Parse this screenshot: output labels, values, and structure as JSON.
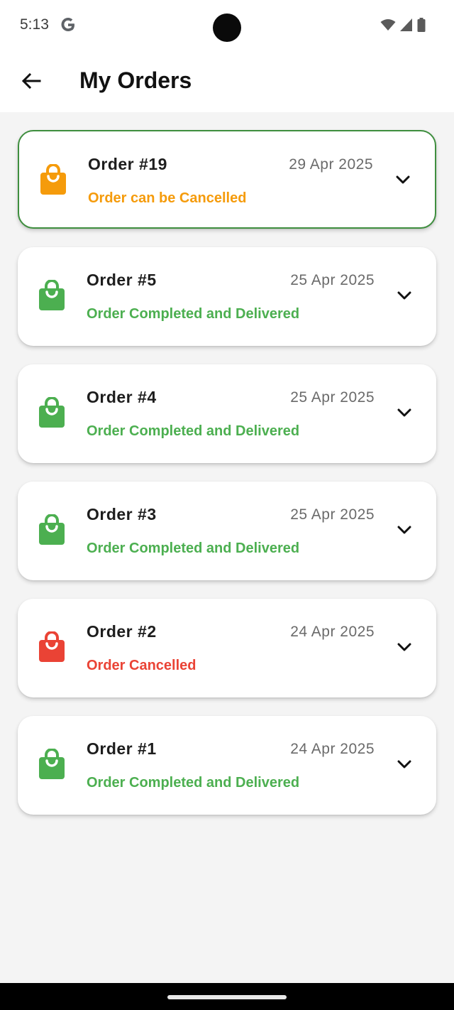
{
  "status_bar": {
    "time": "5:13",
    "icons": [
      "google-g-icon",
      "wifi-icon",
      "cellular-signal-icon",
      "battery-icon"
    ]
  },
  "app_bar": {
    "title": "My Orders",
    "back_icon": "arrow-back-icon"
  },
  "colors": {
    "orange": "#f59b0b",
    "green": "#4caf50",
    "red": "#ea4335",
    "highlight_border": "#3e8e3e"
  },
  "orders": [
    {
      "number": "Order #19",
      "date": "29 Apr 2025",
      "status": "Order can be Cancelled",
      "status_color": "#f59b0b",
      "highlighted": true
    },
    {
      "number": "Order #5",
      "date": "25 Apr 2025",
      "status": "Order Completed and Delivered",
      "status_color": "#4caf50",
      "highlighted": false
    },
    {
      "number": "Order #4",
      "date": "25 Apr 2025",
      "status": "Order Completed and Delivered",
      "status_color": "#4caf50",
      "highlighted": false
    },
    {
      "number": "Order #3",
      "date": "25 Apr 2025",
      "status": "Order Completed and Delivered",
      "status_color": "#4caf50",
      "highlighted": false
    },
    {
      "number": "Order #2",
      "date": "24 Apr 2025",
      "status": "Order Cancelled",
      "status_color": "#ea4335",
      "highlighted": false
    },
    {
      "number": "Order #1",
      "date": "24 Apr 2025",
      "status": "Order Completed and Delivered",
      "status_color": "#4caf50",
      "highlighted": false
    }
  ]
}
